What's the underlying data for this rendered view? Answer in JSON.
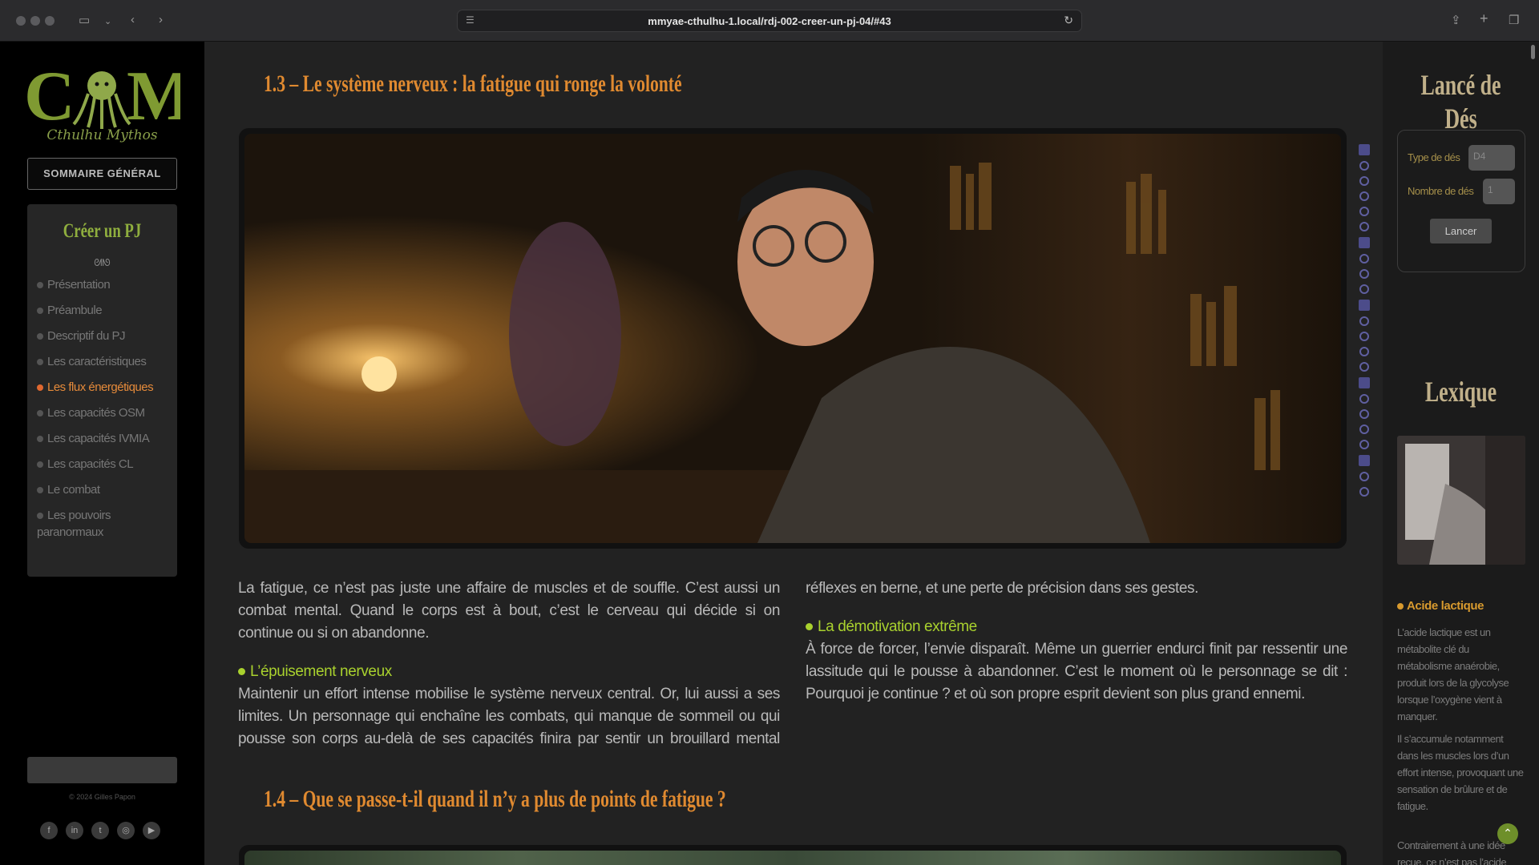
{
  "browser": {
    "url": "mmyae-cthulhu-1.local/rdj-002-creer-un-pj-04/#43"
  },
  "sidebar": {
    "logo_text": "Cthulhu Mythos",
    "summary_button": "SOMMAIRE GÉNÉRAL",
    "toc_title": "Créer un PJ",
    "toc_ornament": "ᘛᘚ",
    "items": [
      {
        "label": "Présentation",
        "active": false
      },
      {
        "label": "Préambule",
        "active": false
      },
      {
        "label": "Descriptif du PJ",
        "active": false
      },
      {
        "label": "Les caractéristiques",
        "active": false
      },
      {
        "label": "Les flux énergétiques",
        "active": true
      },
      {
        "label": "Les capacités OSM",
        "active": false
      },
      {
        "label": "Les capacités IVMIA",
        "active": false
      },
      {
        "label": "Les capacités CL",
        "active": false
      },
      {
        "label": "Le combat",
        "active": false
      },
      {
        "label": "Les pouvoirs paranormaux",
        "active": false
      }
    ],
    "copyright": "© 2024 Gilles Papon",
    "socials": [
      "facebook-icon",
      "linkedin-icon",
      "twitter-icon",
      "instagram-icon",
      "youtube-icon"
    ]
  },
  "main": {
    "section_13_title": "1.3 – Le système nerveux : la fatigue qui ronge la volonté",
    "intro": "La fatigue, ce n’est pas juste une affaire de muscles et de souffle. C’est aussi un combat mental. Quand le corps est à bout, c’est le cerveau qui décide si on continue ou si on abandonne.",
    "sub1_title": "L’épuisement nerveux",
    "sub1_text": "Maintenir un effort intense mobilise le système nerveux central. Or, lui aussi a ses limites. Un personnage qui enchaîne les combats, qui manque de sommeil ou qui pousse son corps au-delà de ses capacités finira par sentir un brouillard mental s’installer. Réactions plus lentes, réflexes en berne, et une perte de précision dans ses gestes.",
    "sub2_title": "La démotivation extrême",
    "sub2_text": "À force de forcer, l’envie disparaît. Même un guerrier endurci finit par ressentir une lassitude qui le pousse à abandonner. C’est le moment où le personnage se dit : Pourquoi je continue ? et où son propre esprit devient son plus grand ennemi.",
    "section_14_title": "1.4 – Que se passe-t-il quand il n’y a plus de points de fatigue ?"
  },
  "right": {
    "dice_title": "Lancé de Dés",
    "dice_type_label": "Type de dés",
    "dice_type_value": "D4",
    "dice_count_label": "Nombre de dés",
    "dice_count_value": "1",
    "roll_button": "Lancer",
    "lexicon_title": "Lexique",
    "term": "Acide lactique",
    "def1": "L’acide lactique est un métabolite clé du métabolisme anaérobie, produit lors de la glycolyse lorsque l’oxygène vient à manquer.",
    "def2": "Il s’accumule notamment dans les muscles lors d’un effort intense, provoquant une sensation de brûlure et de fatigue.",
    "def3": "Contrairement à une idée reçue, ce n’est pas l’acide lactique lui-"
  },
  "colors": {
    "accent_orange": "#e08a30",
    "accent_green": "#a9d12e",
    "active_item": "#e58a3a"
  }
}
